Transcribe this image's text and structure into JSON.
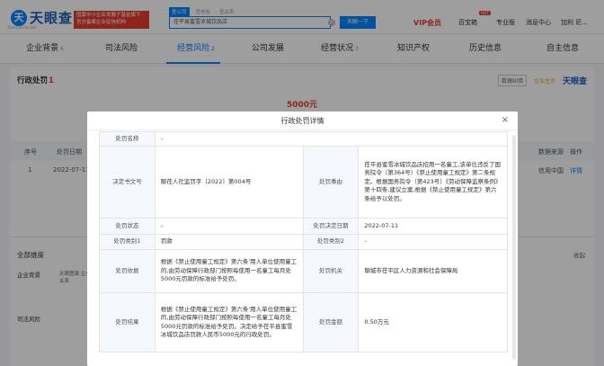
{
  "header": {
    "logo_glyph": "天",
    "logo_text": "天眼查",
    "logo_sub": "TianYanCha.com",
    "red_badge": "国家中小企业发展子基金旗下 官方备案企业征信机构",
    "search_tabs": [
      "查公司",
      "查老板",
      "查关系"
    ],
    "search_value": "茌平县蜜雪冰城饮品店",
    "search_button": "天眼一下",
    "vip": "VIP会员",
    "right_items": [
      "百宝箱",
      "专业版",
      "消息中心",
      "加利 尼..."
    ],
    "hot_label": "HOT"
  },
  "nav": {
    "items": [
      {
        "label": "企业背景",
        "count": "6"
      },
      {
        "label": "司法风险",
        "count": ""
      },
      {
        "label": "经营风险",
        "count": "2"
      },
      {
        "label": "公司发展",
        "count": ""
      },
      {
        "label": "经营状况",
        "count": "3"
      },
      {
        "label": "知识产权",
        "count": ""
      },
      {
        "label": "历史信息",
        "count": ""
      },
      {
        "label": "自主信息",
        "count": ""
      }
    ]
  },
  "section": {
    "title": "行政处罚",
    "count": "1",
    "tools": {
      "data_label": "数据纠错",
      "watch_label": "企业主页",
      "brand": "天眼查"
    },
    "amount": "5000元",
    "table_headers": [
      "序号",
      "处罚日期",
      "数据来源",
      "操作"
    ],
    "row": {
      "index": "1",
      "date": "2022-07-11",
      "source": "信用中国",
      "action": "详情"
    }
  },
  "lower": {
    "title": "全部维度",
    "collapse": "收起",
    "rows": [
      {
        "label": "企业背景",
        "sub": "天眼图谱 企业关系"
      },
      {
        "label": "司法风险",
        "sub": ""
      }
    ]
  },
  "modal": {
    "title": "行政处罚详情",
    "close": "×",
    "rows": [
      {
        "l1": "处罚名称",
        "v1": "-",
        "l2": "",
        "v2": ""
      },
      {
        "l1": "决定书文号",
        "v1": "聊茌人社监罚字〔2022〕第004号",
        "l2": "处罚事由",
        "v2": "茌平县蜜雪冰城饮品店招用一名童工,该单位违反了国务院令（第364号）《禁止使用童工规定》第二条规定。根据国务院令（第423号）《劳动保障监察条例》第十四条,建议立案,根据《禁止使用童工规定》第六条给予以处罚。"
      },
      {
        "l1": "处罚状态",
        "v1": "-",
        "l2": "处罚决定日期",
        "v2": "2022-07-11"
      },
      {
        "l1": "处罚类别1",
        "v1": "罚款",
        "l2": "处罚类别2",
        "v2": "-"
      },
      {
        "l1": "处罚依据",
        "v1": "根据《禁止使用童工规定》第六条'用人单位使用童工的,由劳动保障行政部门按照每使用一名童工每月处5000元罚款的标准给予处罚。",
        "l2": "处罚机关",
        "v2": "聊城市茌平区人力资源和社会保障局"
      },
      {
        "l1": "处罚结果",
        "v1": "根据《禁止使用童工规定》第六条'用人单位使用童工的,由劳动保障行政部门按照每使用一名童工每月处5000元罚款的标准给予处罚。决定给予茌平县蜜雪冰城饮品店罚款人民币5000元的行政处罚。",
        "l2": "处罚金额",
        "v2": "0.50万元"
      }
    ]
  },
  "colors": {
    "accent": "#0084ff",
    "red": "#e63d2e",
    "label_bg": "#f5f8fc"
  }
}
